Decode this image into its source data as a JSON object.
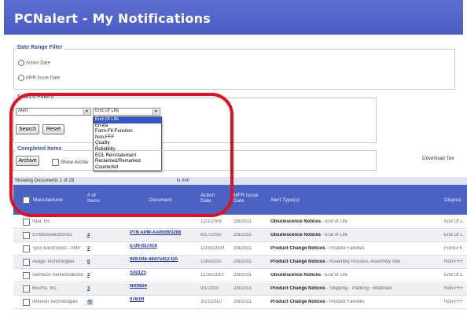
{
  "header": {
    "title": "PCNalert - My Notifications"
  },
  "date_filter": {
    "legend": "Date Range Filter",
    "options": [
      "Action Date",
      "MFR Issue Date"
    ]
  },
  "search": {
    "legend": "Search Filters",
    "select1_value": "Alert",
    "select2_value": "End Of Life",
    "search_label": "Search",
    "reset_label": "Reset",
    "dropdown_options": [
      "End Of Life",
      "Errata",
      "Form-Fit-Function",
      "Non-FFF",
      "Quality",
      "Reliability",
      "EOL Reinstatement",
      "Reclaimed/Remarked",
      "Counterfeit"
    ],
    "dropdown_selected": 0
  },
  "completed": {
    "legend": "Completed Items",
    "archive_label": "Archive",
    "show_archive_label": "Show Archiv"
  },
  "download_label": "Download Tex",
  "table": {
    "showing_text": "Showing Documents 1 of 28",
    "header_partial": "ls ###",
    "columns": [
      "Manufacturer",
      "# of Items",
      "Document",
      "Action Date",
      "MFR Issue Date",
      "Alert Type(s)",
      "Disposi"
    ],
    "rows": [
      {
        "mfr": "Intel, Inc",
        "items": "",
        "doc": "",
        "action": "12/1/2009",
        "issue": "2/8/2011",
        "alert": "Obsolescence Notices",
        "alert_detail": "End of Life",
        "disp": "End Of L"
      },
      {
        "mfr": "STMicroelectronics",
        "items": "2",
        "doc": "PTN APM-AAR/09/3208",
        "action": "6/17/2010",
        "issue": "2/8/2011",
        "alert": "Obsolescence Notices",
        "alert_detail": "End of Life",
        "disp": "End Of L"
      },
      {
        "mfr": "Tyco Electronics - AMP",
        "items": "2",
        "doc": "E-09-027419",
        "action": "12/30/2009",
        "issue": "2/8/2011",
        "alert": "Product Change Notices",
        "alert_detail": "Product Families",
        "disp": "Form-Fit"
      },
      {
        "mfr": "Avago Technologies",
        "items": "6",
        "doc": "909-045-48475412-DA",
        "action": "1/30/2010",
        "issue": "2/8/2011",
        "alert": "Product Change Notices",
        "alert_detail": "Assembly Process, Assembly Site",
        "disp": "Non-FFF"
      },
      {
        "mfr": "Semtech Semiconductor",
        "items": "2",
        "doc": "S30125",
        "action": "11/30/2010",
        "issue": "2/8/2011",
        "alert": "Obsolescence Notices",
        "alert_detail": "End of Life",
        "disp": "End Of L"
      },
      {
        "mfr": "Bourns, Inc.",
        "items": "3",
        "doc": "NR0834",
        "action": "3/1/2010",
        "issue": "2/8/2011",
        "alert": "Product Change Notices",
        "alert_detail": "Shipping - Packing - Materials",
        "disp": "Non-FFF"
      },
      {
        "mfr": "Infineon Technologies",
        "items": "40",
        "doc": "076/09",
        "action": "3/21/2010",
        "issue": "2/8/2011",
        "alert": "Product Change Notices",
        "alert_detail": "Product Families",
        "disp": "Non-FFF"
      }
    ]
  },
  "colors": {
    "header_blue": "#4a5cc4",
    "highlight_ring": "#e01020",
    "link": "#2233aa"
  }
}
